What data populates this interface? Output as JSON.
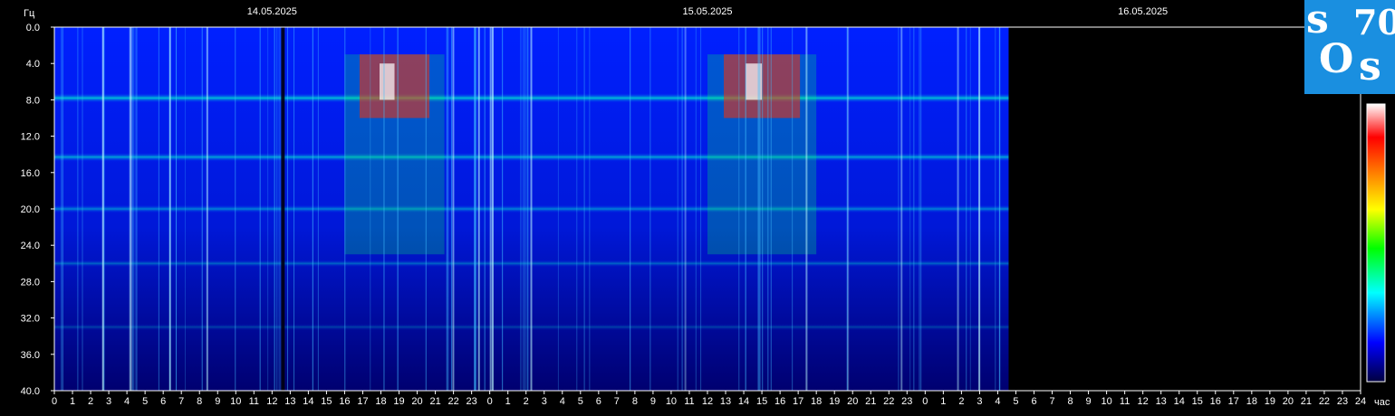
{
  "chart_data": {
    "type": "heatmap",
    "title": "",
    "ylabel": "Гц",
    "xlabel": "час",
    "ylim": [
      0,
      40
    ],
    "y_ticks": [
      "0.0",
      "4.0",
      "8.0",
      "12.0",
      "16.0",
      "20.0",
      "24.0",
      "28.0",
      "32.0",
      "36.0",
      "40.0"
    ],
    "dates": [
      "14.05.2025",
      "15.05.2025",
      "16.05.2025"
    ],
    "hours": [
      "0",
      "1",
      "2",
      "3",
      "4",
      "5",
      "6",
      "7",
      "8",
      "9",
      "10",
      "11",
      "12",
      "13",
      "14",
      "15",
      "16",
      "17",
      "18",
      "19",
      "20",
      "21",
      "22",
      "23"
    ],
    "final_hour": "24",
    "data_end_hour": 52.6,
    "colorscale": [
      "#000040",
      "#0000ff",
      "#00ffff",
      "#00ff00",
      "#ffff00",
      "#ff8000",
      "#ff0000",
      "#ffffff"
    ],
    "bands_hz": [
      7.8,
      14.3,
      20.0,
      26.0,
      33.0
    ],
    "intense_periods_hours": [
      [
        16.0,
        21.5
      ],
      [
        36.0,
        42.0
      ]
    ]
  },
  "logo": {
    "text": [
      "s",
      "70",
      "O",
      "s"
    ]
  }
}
